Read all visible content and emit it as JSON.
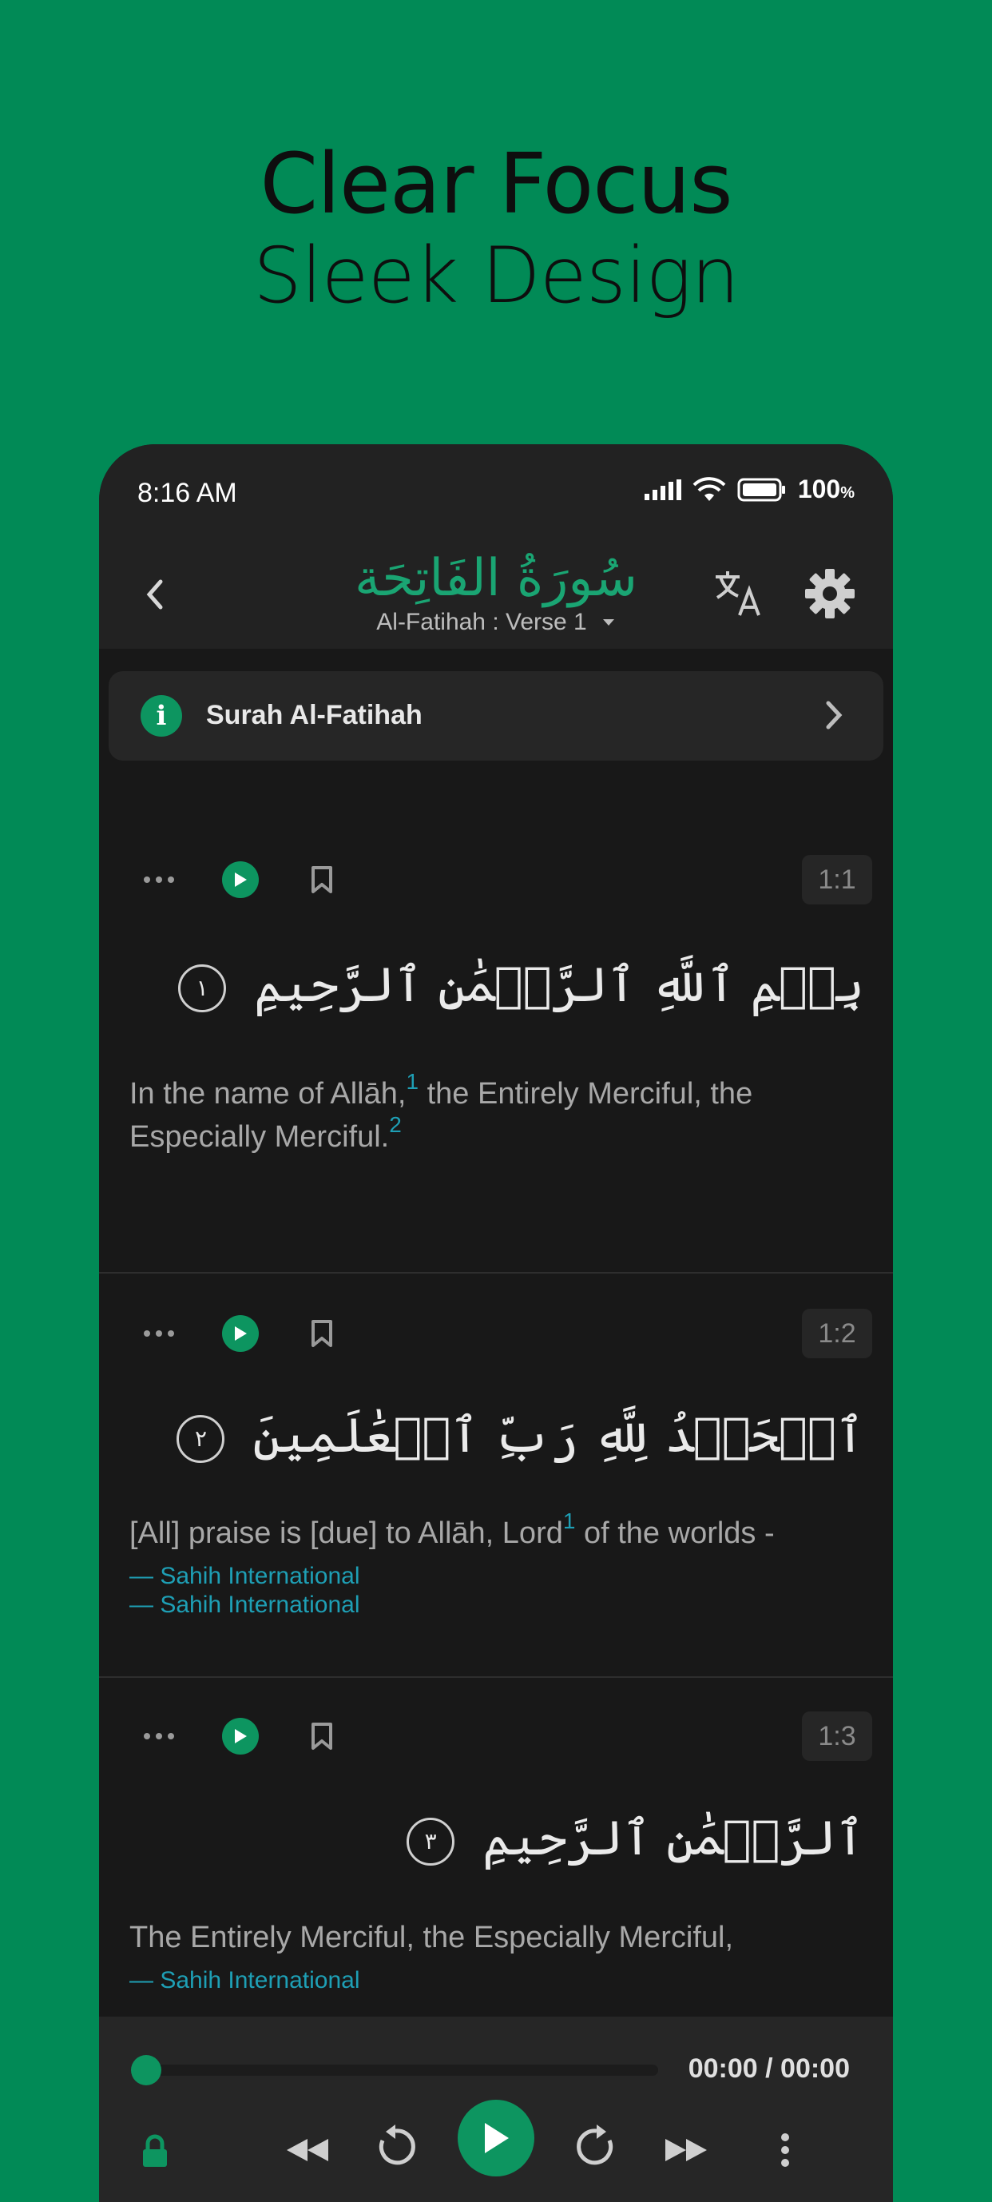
{
  "promo": {
    "title": "Clear Focus",
    "subtitle": "Sleek Design"
  },
  "status": {
    "time": "8:16 AM",
    "battery": "100",
    "battery_unit": "%"
  },
  "header": {
    "surah_arabic": "سُورَةُ الفَاتِحَة",
    "location": "Al-Fatihah : Verse 1"
  },
  "info_card": {
    "label": "Surah Al-Fatihah"
  },
  "verses": [
    {
      "number": "1:1",
      "arabic": "بِسۡمِ ٱللَّهِ ٱلرَّحۡمَٰنِ ٱلرَّحِيمِ",
      "ayah_mark": "١",
      "translation_a": "In the name of Allāh,",
      "footnote_a": "1",
      "translation_b": " the Entirely Merciful, the Especially Merciful.",
      "footnote_b": "2",
      "source": "— Sahih International"
    },
    {
      "number": "1:2",
      "arabic": "ٱلۡحَمۡدُ لِلَّهِ رَبِّ ٱلۡعَٰلَمِينَ",
      "ayah_mark": "٢",
      "translation_a": "[All] praise is [due] to Allāh, Lord",
      "footnote_a": "1",
      "translation_b": " of the worlds -",
      "source": "— Sahih International"
    },
    {
      "number": "1:3",
      "arabic": "ٱلرَّحۡمَٰنِ ٱلرَّحِيمِ",
      "ayah_mark": "٣",
      "translation_a": "The Entirely Merciful, the Especially Merciful,",
      "source": "— Sahih International"
    }
  ],
  "player": {
    "time": "00:00 / 00:00",
    "progress": 0
  },
  "colors": {
    "background": "#018a56",
    "accent": "#0d9560",
    "link": "#1e9fb5",
    "surface": "#181818"
  },
  "icons": [
    "back-icon",
    "translate-icon",
    "settings-icon",
    "info-icon",
    "chevron-right-icon",
    "more-icon",
    "play-icon",
    "bookmark-icon",
    "lock-icon",
    "rewind-icon",
    "replay-5-icon",
    "forward-5-icon",
    "fast-forward-icon"
  ]
}
